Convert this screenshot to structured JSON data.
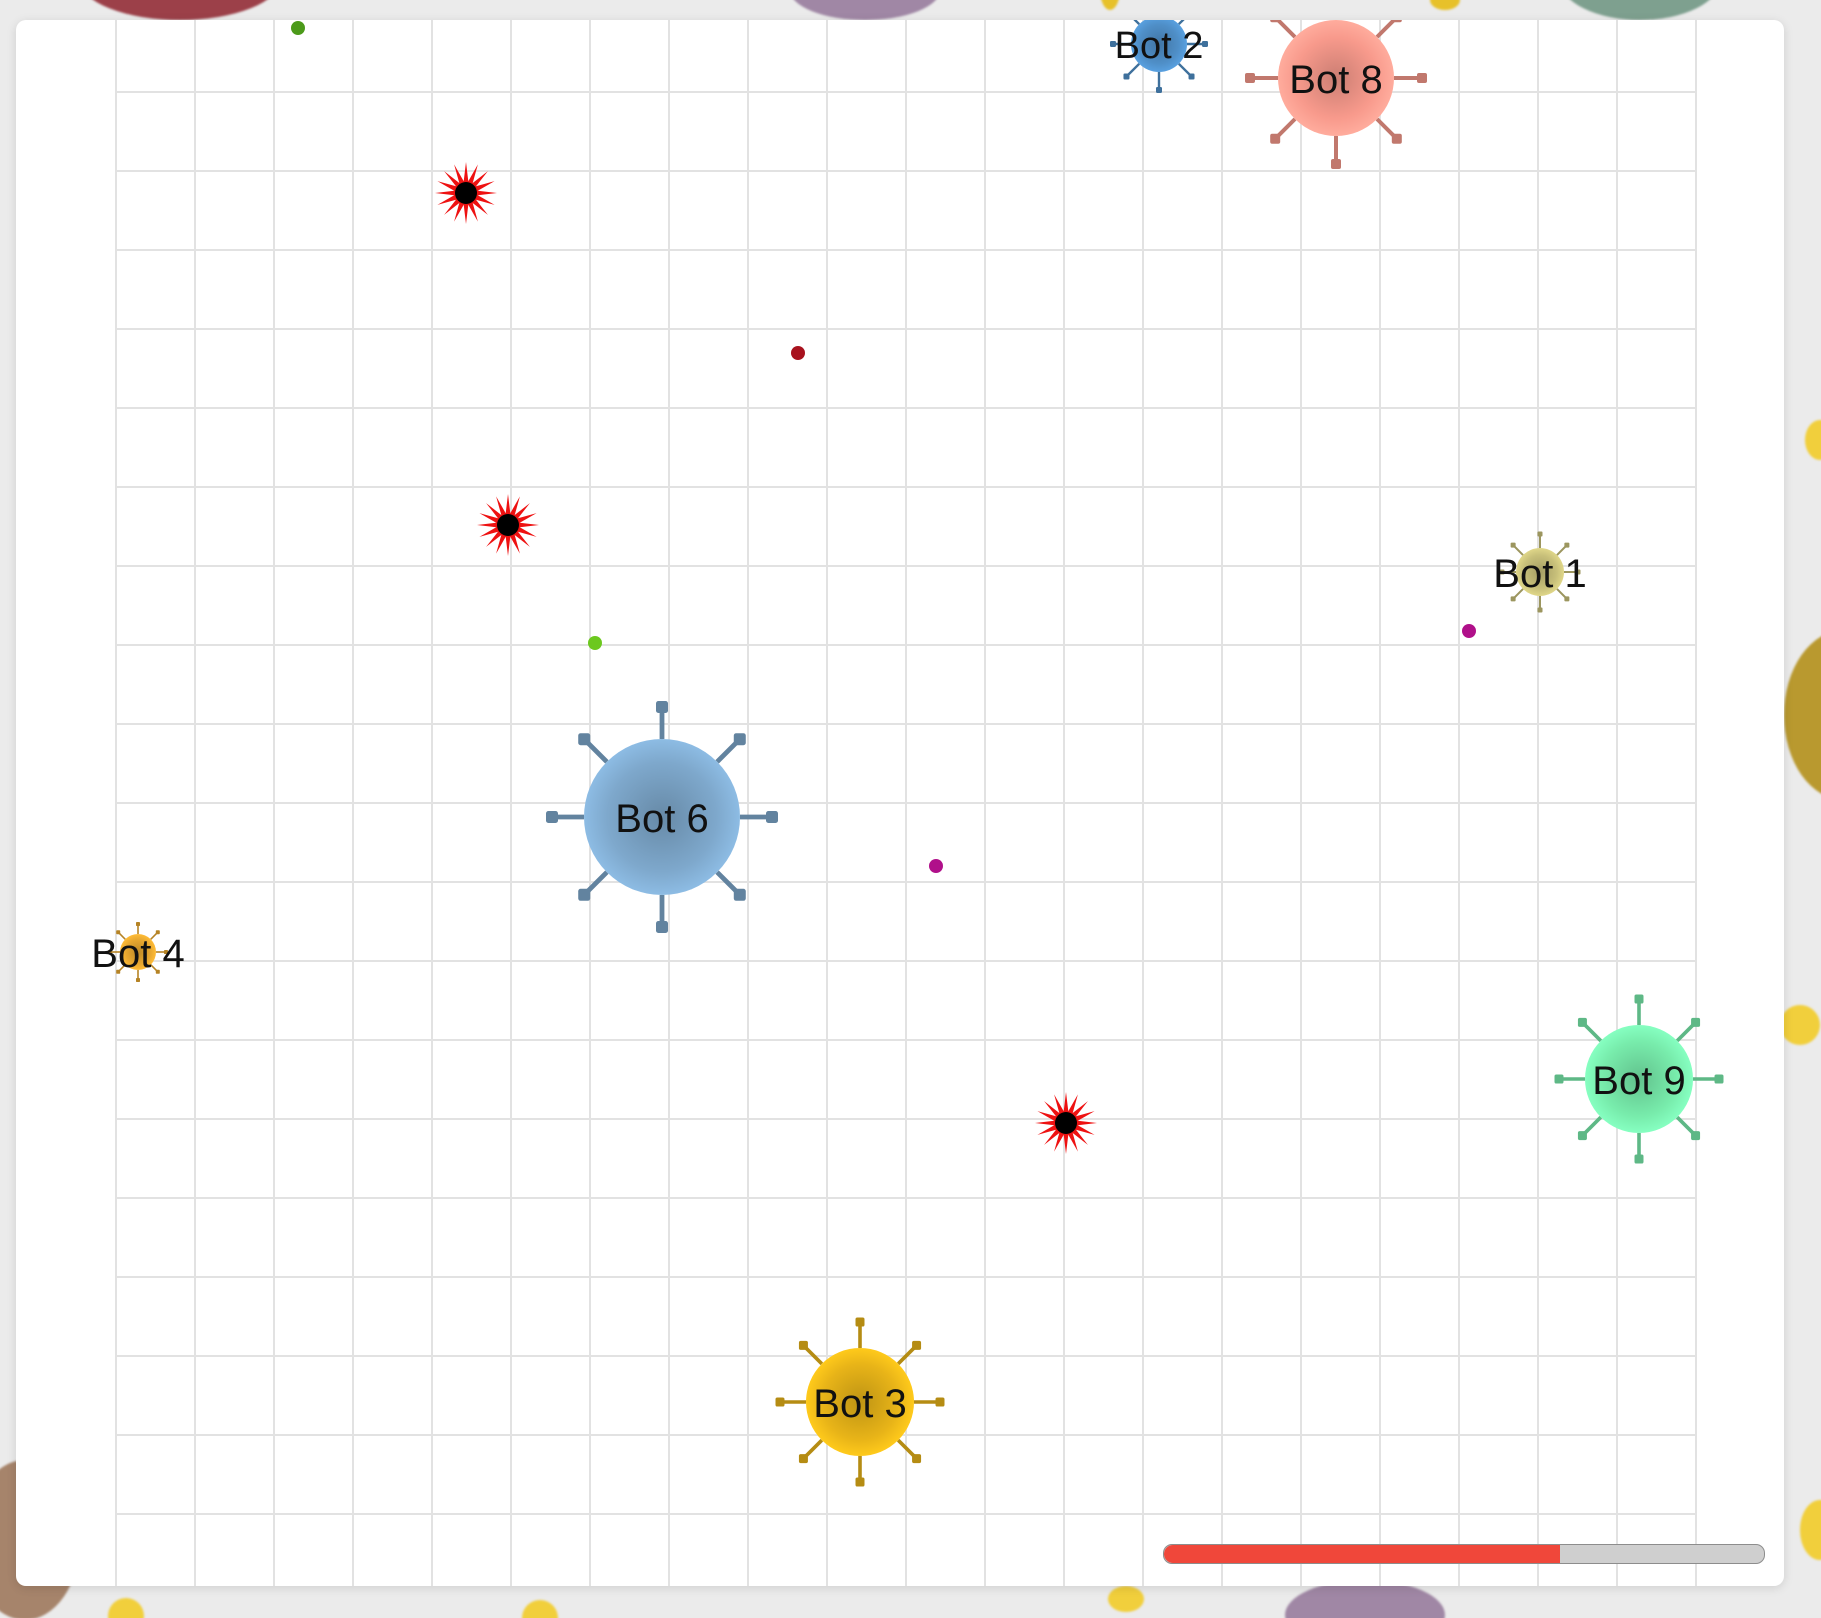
{
  "game": {
    "cells": [
      {
        "name": "Bot 2",
        "color": "#4f8fc8",
        "radius_units": 0.55,
        "mass": 1
      },
      {
        "name": "Bot 8",
        "color": "#f89a8c",
        "radius_units": 1.45,
        "mass": 5
      },
      {
        "name": "Bot 1",
        "color": "#c8c07a",
        "radius_units": 0.55,
        "mass": 1
      },
      {
        "name": "Bot 6",
        "color": "#7ea8cc",
        "radius_units": 2.0,
        "mass": 9
      },
      {
        "name": "Bot 4",
        "color": "#e8a830",
        "radius_units": 0.45,
        "mass": 1
      },
      {
        "name": "Bot 9",
        "color": "#78ecac",
        "radius_units": 1.35,
        "mass": 5
      },
      {
        "name": "Bot 3",
        "color": "#e8b418",
        "radius_units": 1.35,
        "mass": 5
      }
    ],
    "viruses": [
      {
        "label": "virus-1"
      },
      {
        "label": "virus-2"
      },
      {
        "label": "virus-3"
      }
    ],
    "food": [
      {
        "color": "#4c9a1a"
      },
      {
        "color": "#a8121e"
      },
      {
        "color": "#6cc81e"
      },
      {
        "color": "#b0108a"
      },
      {
        "color": "#b0108a"
      }
    ],
    "virus_color": "#ee1111",
    "grid_color": "#e2e2e2"
  },
  "progress": {
    "value": 0.66,
    "fill_color": "#f0473a",
    "track_color": "#cfcfcf"
  }
}
